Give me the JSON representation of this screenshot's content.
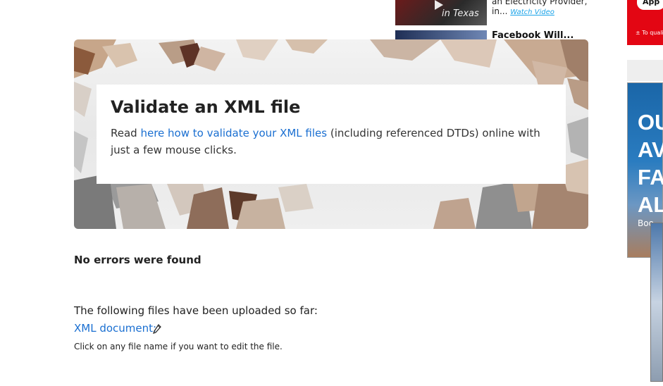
{
  "ads": {
    "thumb1_caption": "in Texas",
    "line1": "an Electricity Provider,",
    "line2_prefix": "in...",
    "watch_label": "Watch Video",
    "title2": "Facebook Will...",
    "side_button": "App",
    "side_small": "± To qualify",
    "side_big": [
      "OU",
      "AV",
      "FA",
      "AL"
    ],
    "side_book": "Boo"
  },
  "hero": {
    "title": "Validate an XML file",
    "text_before": "Read ",
    "link_text": "here how to validate your XML files",
    "text_after": " (including referenced DTDs) online with just a few mouse clicks."
  },
  "status": "No errors were found",
  "uploaded_label": "The following files have been uploaded so far:",
  "file_link": "XML document:",
  "hint": "Click on any file name if you want to edit the file.",
  "icons": {
    "edit": "pencil-icon",
    "play": "play-icon"
  }
}
